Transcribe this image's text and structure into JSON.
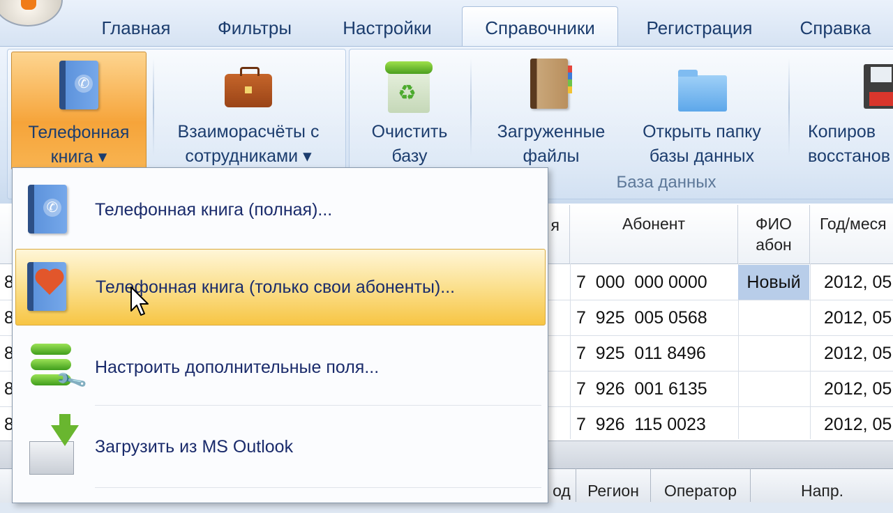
{
  "tabs": [
    "Главная",
    "Фильтры",
    "Настройки",
    "Справочники",
    "Регистрация",
    "Справка"
  ],
  "active_tab": "Справочники",
  "ribbon": {
    "phonebook": {
      "line1": "Телефонная",
      "line2": "книга ▾"
    },
    "settlements": {
      "line1": "Взаиморасчёты с",
      "line2": "сотрудниками ▾"
    },
    "clear_db": {
      "line1": "Очистить",
      "line2": "базу"
    },
    "loaded_files": {
      "line1": "Загруженные",
      "line2": "файлы"
    },
    "open_folder": {
      "line1": "Открыть папку",
      "line2": "базы данных"
    },
    "copy_restore": {
      "line1": "Копиров",
      "line2": "восстанов"
    },
    "group_label": "База данных"
  },
  "grid": {
    "headers": {
      "col0": "я",
      "subscriber": "Абонент",
      "fio_line1": "ФИО",
      "fio_line2": "абон",
      "year_month": "Год/меся"
    },
    "rows": [
      {
        "first": "8",
        "subscriber": "7  000  000 0000",
        "fio": "Новый",
        "date": "2012, 05"
      },
      {
        "first": "8",
        "subscriber": "7  925  005 0568",
        "fio": "",
        "date": "2012, 05"
      },
      {
        "first": "8",
        "subscriber": "7  925  011 8496",
        "fio": "",
        "date": "2012, 05"
      },
      {
        "first": "8",
        "subscriber": "7  926  001 6135",
        "fio": "",
        "date": "2012, 05"
      },
      {
        "first": "8",
        "subscriber": "7  926  115 0023",
        "fio": "",
        "date": "2012, 05"
      }
    ]
  },
  "footer": {
    "col1": "од",
    "col2": "Регион",
    "col3": "Оператор",
    "col4": "Напр."
  },
  "menu": {
    "items": [
      {
        "label": "Телефонная книга (полная)...",
        "icon": "phonebook-icon"
      },
      {
        "label": "Телефонная книга (только свои абоненты)...",
        "icon": "favorite-phonebook-icon"
      },
      {
        "label": "Настроить дополнительные поля...",
        "icon": "fields-settings-icon"
      },
      {
        "label": "Загрузить из MS Outlook",
        "icon": "outlook-import-icon"
      }
    ]
  },
  "colors": {
    "highlight": "#f7c544",
    "ribbon_hot": "#f6a43a",
    "menu_text": "#1a2b6b"
  }
}
